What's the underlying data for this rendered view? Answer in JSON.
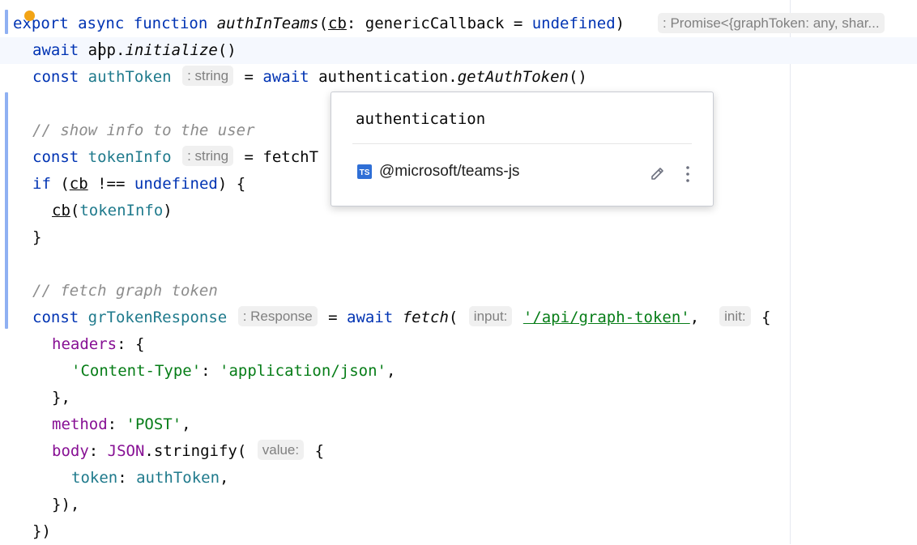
{
  "editor": {
    "lines": {
      "l1": {
        "kw_export": "export",
        "kw_async": "async",
        "kw_function": "function",
        "fn_name": "authInTeams",
        "open": "(",
        "param": "cb",
        "colon": ": ",
        "type": "genericCallback",
        "eq": " = ",
        "undef": "undefined",
        "close": ")"
      },
      "l2": {
        "kw_await": "await",
        "obj": "app",
        "dot": ".",
        "method": "initialize",
        "call": "()"
      },
      "l3": {
        "kw_const": "const",
        "var": "authToken",
        "eq": " = ",
        "kw_await": "await",
        "obj": "authentication",
        "dot": ".",
        "method": "getAuthToken",
        "call": "()"
      },
      "l5": {
        "comment": "// show info to the user"
      },
      "l6": {
        "kw_const": "const",
        "var": "tokenInfo",
        "eq": " = ",
        "partial": "fetchT"
      },
      "l7": {
        "kw_if": "if",
        "open": " (",
        "param": "cb",
        "op": " !== ",
        "undef": "undefined",
        "close": ") {"
      },
      "l8": {
        "param": "cb",
        "open": "(",
        "arg": "tokenInfo",
        "close": ")"
      },
      "l9": {
        "brace": "}"
      },
      "l11": {
        "comment": "// fetch graph token"
      },
      "l12": {
        "kw_const": "const",
        "var": "grTokenResponse",
        "eq": " = ",
        "kw_await": "await",
        "fn": "fetch",
        "open": "(",
        "url": "'/api/graph-token'",
        "comma": ", ",
        "brace": "{"
      },
      "l13": {
        "prop": "headers",
        "rest": ": {"
      },
      "l14": {
        "key": "'Content-Type'",
        "colon": ": ",
        "value": "'application/json'",
        "comma": ","
      },
      "l15": {
        "text": "},"
      },
      "l16": {
        "prop": "method",
        "colon": ": ",
        "value": "'POST'",
        "comma": ","
      },
      "l17": {
        "prop": "body",
        "colon": ": ",
        "json": "JSON",
        "dot": ".",
        "method": "stringify",
        "open": "(",
        "brace": "{"
      },
      "l18": {
        "prop": "token",
        "colon": ": ",
        "value": "authToken",
        "comma": ","
      },
      "l19": {
        "text": "}),"
      },
      "l20": {
        "text": "})"
      }
    },
    "hints": {
      "return_type": ": Promise<{graphToken: any, shar...",
      "authToken_type": ": string",
      "tokenInfo_type": ": string",
      "grTokenResponse_type": ": Response",
      "input_param": "input:",
      "init_param": "init:",
      "value_param": "value:"
    }
  },
  "popup": {
    "title": "authentication",
    "module_icon": "TS",
    "module_name": "@microsoft/teams-js",
    "edit_icon": "pencil-icon",
    "more_icon": "vertical-dots-icon"
  },
  "colors": {
    "keyword": "#0033b3",
    "variable": "#1f7a8c",
    "string": "#067d17",
    "property": "#871094",
    "comment": "#8c8c8c",
    "current_line": "#f5f8fe",
    "gutter_change": "#8fb0f2",
    "ts_icon": "#2f6fd6"
  }
}
